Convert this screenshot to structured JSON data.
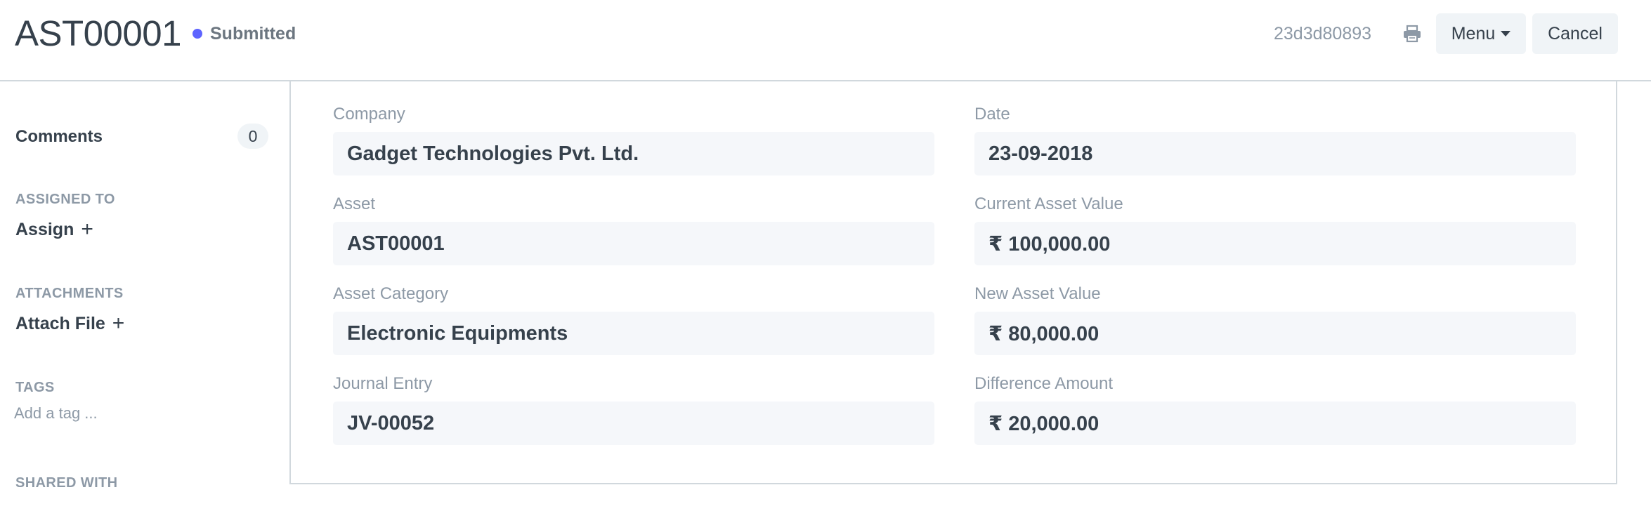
{
  "header": {
    "title": "AST00001",
    "status": "Submitted",
    "status_color": "#5e64ff",
    "doc_hash": "23d3d80893",
    "print_icon": "printer-icon",
    "menu_label": "Menu",
    "cancel_label": "Cancel"
  },
  "sidebar": {
    "comments_label": "Comments",
    "comments_count": "0",
    "assigned_to_label": "ASSIGNED TO",
    "assign_label": "Assign",
    "attachments_label": "ATTACHMENTS",
    "attach_label": "Attach File",
    "tags_label": "TAGS",
    "tag_placeholder": "Add a tag ...",
    "shared_with_label": "SHARED WITH"
  },
  "form": {
    "company": {
      "label": "Company",
      "value": "Gadget Technologies Pvt. Ltd."
    },
    "date": {
      "label": "Date",
      "value": "23-09-2018"
    },
    "asset": {
      "label": "Asset",
      "value": "AST00001"
    },
    "current_asset_value": {
      "label": "Current Asset Value",
      "value": "₹ 100,000.00"
    },
    "asset_category": {
      "label": "Asset Category",
      "value": "Electronic Equipments"
    },
    "new_asset_value": {
      "label": "New Asset Value",
      "value": "₹ 80,000.00"
    },
    "journal_entry": {
      "label": "Journal Entry",
      "value": "JV-00052"
    },
    "difference_amount": {
      "label": "Difference Amount",
      "value": "₹ 20,000.00"
    }
  }
}
